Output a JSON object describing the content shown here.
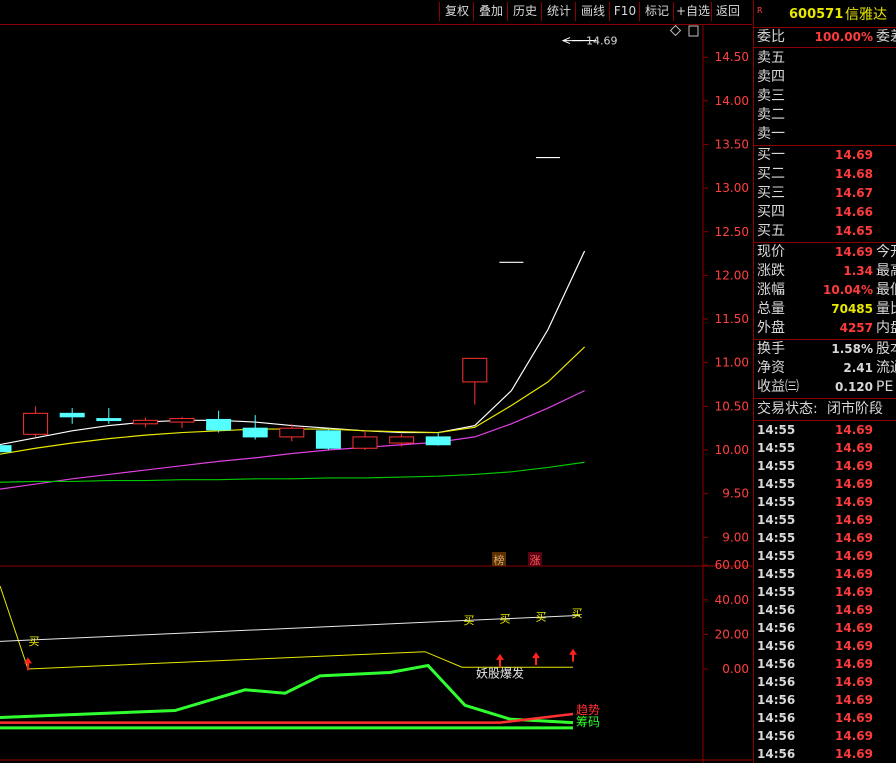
{
  "toolbar": [
    "复权",
    "叠加",
    "历史",
    "统计",
    "画线",
    "F10",
    "标记",
    "+自选",
    "返回"
  ],
  "stock": {
    "badge": "R",
    "code": "600571",
    "name": "信雅达"
  },
  "commit": {
    "label": "委比",
    "value": "100.00%",
    "label2": "委差"
  },
  "asks": [
    {
      "label": "卖五",
      "price": ""
    },
    {
      "label": "卖四",
      "price": ""
    },
    {
      "label": "卖三",
      "price": ""
    },
    {
      "label": "卖二",
      "price": ""
    },
    {
      "label": "卖一",
      "price": ""
    }
  ],
  "bids": [
    {
      "label": "买一",
      "price": "14.69"
    },
    {
      "label": "买二",
      "price": "14.68"
    },
    {
      "label": "买三",
      "price": "14.67"
    },
    {
      "label": "买四",
      "price": "14.66"
    },
    {
      "label": "买五",
      "price": "14.65"
    }
  ],
  "quote": [
    {
      "label": "现价",
      "value": "14.69",
      "value_color": "#ff3c3c",
      "label2": "今开"
    },
    {
      "label": "涨跌",
      "value": "1.34",
      "value_color": "#ff3c3c",
      "label2": "最高"
    },
    {
      "label": "涨幅",
      "value": "10.04%",
      "value_color": "#ff3c3c",
      "label2": "最低"
    },
    {
      "label": "总量",
      "value": "70485",
      "value_color": "#e8e800",
      "label2": "量比"
    },
    {
      "label": "外盘",
      "value": "4257",
      "value_color": "#ff3c3c",
      "label2": "内盘"
    }
  ],
  "stats": [
    {
      "label": "换手",
      "value": "1.58%",
      "value_color": "#d8d8d8",
      "label2": "股本"
    },
    {
      "label": "净资",
      "value": "2.41",
      "value_color": "#d8d8d8",
      "label2": "流通"
    },
    {
      "label": "收益㈢",
      "value": "0.120",
      "value_color": "#d8d8d8",
      "label2": "PE"
    }
  ],
  "trade_status": {
    "label": "交易状态:",
    "value": "闭市阶段"
  },
  "ticks": [
    {
      "time": "14:55",
      "price": "14.69"
    },
    {
      "time": "14:55",
      "price": "14.69"
    },
    {
      "time": "14:55",
      "price": "14.69"
    },
    {
      "time": "14:55",
      "price": "14.69"
    },
    {
      "time": "14:55",
      "price": "14.69"
    },
    {
      "time": "14:55",
      "price": "14.69"
    },
    {
      "time": "14:55",
      "price": "14.69"
    },
    {
      "time": "14:55",
      "price": "14.69"
    },
    {
      "time": "14:55",
      "price": "14.69"
    },
    {
      "time": "14:55",
      "price": "14.69"
    },
    {
      "time": "14:56",
      "price": "14.69"
    },
    {
      "time": "14:56",
      "price": "14.69"
    },
    {
      "time": "14:56",
      "price": "14.69"
    },
    {
      "time": "14:56",
      "price": "14.69"
    },
    {
      "time": "14:56",
      "price": "14.69"
    },
    {
      "time": "14:56",
      "price": "14.69"
    },
    {
      "time": "14:56",
      "price": "14.69"
    },
    {
      "time": "14:56",
      "price": "14.69"
    },
    {
      "time": "14:56",
      "price": "14.69"
    }
  ],
  "chart_data": {
    "type": "candlestick",
    "price_axis": {
      "ticks": [
        "14.50",
        "14.00",
        "13.50",
        "13.00",
        "12.50",
        "12.00",
        "11.50",
        "11.00",
        "10.50",
        "10.00",
        "9.50",
        "9.00"
      ]
    },
    "last_price_marker": "14.69",
    "candles": [
      {
        "o": 10.05,
        "h": 10.2,
        "l": 9.9,
        "c": 9.98,
        "up": false
      },
      {
        "o": 10.18,
        "h": 10.5,
        "l": 10.15,
        "c": 10.42,
        "up": true
      },
      {
        "o": 10.38,
        "h": 10.48,
        "l": 10.3,
        "c": 10.42,
        "up": false
      },
      {
        "o": 10.36,
        "h": 10.48,
        "l": 10.3,
        "c": 10.34,
        "up": false
      },
      {
        "o": 10.3,
        "h": 10.37,
        "l": 10.26,
        "c": 10.34,
        "up": true
      },
      {
        "o": 10.32,
        "h": 10.38,
        "l": 10.25,
        "c": 10.36,
        "up": true
      },
      {
        "o": 10.35,
        "h": 10.45,
        "l": 10.2,
        "c": 10.23,
        "up": false
      },
      {
        "o": 10.25,
        "h": 10.4,
        "l": 10.12,
        "c": 10.15,
        "up": false
      },
      {
        "o": 10.15,
        "h": 10.3,
        "l": 10.1,
        "c": 10.25,
        "up": true
      },
      {
        "o": 10.22,
        "h": 10.25,
        "l": 10.0,
        "c": 10.02,
        "up": false
      },
      {
        "o": 10.02,
        "h": 10.22,
        "l": 10.0,
        "c": 10.15,
        "up": true
      },
      {
        "o": 10.08,
        "h": 10.18,
        "l": 10.04,
        "c": 10.15,
        "up": true
      },
      {
        "o": 10.15,
        "h": 10.2,
        "l": 10.05,
        "c": 10.06,
        "up": false
      },
      {
        "o": 10.78,
        "h": 11.05,
        "l": 10.52,
        "c": 11.05,
        "up": true
      },
      {
        "o": 12.15,
        "h": 12.15,
        "l": 12.15,
        "c": 12.15,
        "up": true
      },
      {
        "o": 13.35,
        "h": 13.35,
        "l": 13.35,
        "c": 13.35,
        "up": true
      },
      {
        "o": 14.69,
        "h": 14.69,
        "l": 14.69,
        "c": 14.69,
        "up": true
      }
    ],
    "ma_series": [
      {
        "color": "#ffffff",
        "values": [
          10.06,
          10.14,
          10.22,
          10.28,
          10.32,
          10.34,
          10.34,
          10.32,
          10.28,
          10.25,
          10.22,
          10.2,
          10.2,
          10.28,
          10.68,
          11.38,
          12.28
        ]
      },
      {
        "color": "#e8e800",
        "values": [
          9.95,
          10.02,
          10.08,
          10.13,
          10.17,
          10.2,
          10.22,
          10.24,
          10.24,
          10.24,
          10.22,
          10.21,
          10.2,
          10.26,
          10.51,
          10.78,
          11.18
        ]
      },
      {
        "color": "#e040e0",
        "values": [
          9.55,
          9.61,
          9.67,
          9.72,
          9.77,
          9.82,
          9.87,
          9.91,
          9.96,
          10.0,
          10.03,
          10.06,
          10.09,
          10.15,
          10.3,
          10.48,
          10.68
        ]
      },
      {
        "color": "#00c800",
        "values": [
          9.63,
          9.64,
          9.64,
          9.65,
          9.65,
          9.66,
          9.66,
          9.67,
          9.67,
          9.68,
          9.68,
          9.69,
          9.7,
          9.72,
          9.75,
          9.8,
          9.86
        ]
      }
    ],
    "tags": [
      {
        "text": "榜",
        "color": "#d8a870"
      },
      {
        "text": "涨",
        "color": "#ff6060"
      }
    ],
    "indicator": {
      "axis_ticks": [
        "60.00",
        "40.00",
        "20.00",
        "0.00"
      ],
      "buy_label": "买",
      "caption": "妖股爆发",
      "legend": [
        {
          "text": "趋势",
          "color": "#ff3030"
        },
        {
          "text": "筹码",
          "color": "#30ff30"
        }
      ]
    }
  }
}
